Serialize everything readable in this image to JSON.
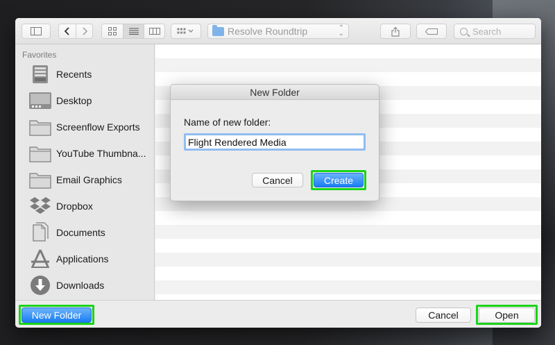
{
  "toolbar": {
    "location": "Resolve Roundtrip",
    "search_placeholder": "Search",
    "icons": [
      "sidebar-toggle-icon",
      "back-icon",
      "forward-icon",
      "icon-view-icon",
      "list-view-icon",
      "column-view-icon",
      "group-by-icon",
      "share-icon",
      "tag-icon",
      "search-icon"
    ]
  },
  "sidebar": {
    "header": "Favorites",
    "items": [
      {
        "label": "Recents",
        "icon": "recents-icon"
      },
      {
        "label": "Desktop",
        "icon": "desktop-icon"
      },
      {
        "label": "Screenflow Exports",
        "icon": "folder-icon"
      },
      {
        "label": "YouTube Thumbna...",
        "icon": "folder-icon"
      },
      {
        "label": "Email Graphics",
        "icon": "folder-icon"
      },
      {
        "label": "Dropbox",
        "icon": "dropbox-icon"
      },
      {
        "label": "Documents",
        "icon": "documents-icon"
      },
      {
        "label": "Applications",
        "icon": "applications-icon"
      },
      {
        "label": "Downloads",
        "icon": "downloads-icon"
      }
    ]
  },
  "bottom": {
    "new_folder": "New Folder",
    "cancel": "Cancel",
    "open": "Open"
  },
  "dialog": {
    "title": "New Folder",
    "prompt": "Name of new folder:",
    "input_value": "Flight Rendered Media",
    "cancel": "Cancel",
    "create": "Create"
  },
  "colors": {
    "accent_blue": "#1a7df2",
    "highlight_green": "#19d419"
  }
}
